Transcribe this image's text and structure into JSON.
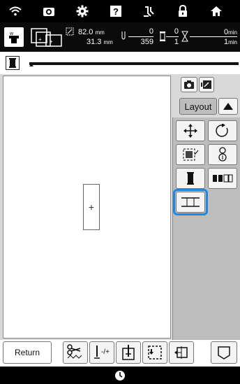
{
  "info": {
    "width_value": "82.0",
    "width_unit": "mm",
    "height_value": "31.3",
    "height_unit": "mm",
    "stitch_top": "0",
    "stitch_bottom": "359",
    "color_top": "0",
    "color_bottom": "1",
    "time_top": "0",
    "time_top_unit": "min",
    "time_bottom": "1",
    "time_bottom_unit": "min"
  },
  "canvas": {
    "crosshair": "+"
  },
  "right_panel": {
    "layout_label": "Layout"
  },
  "bottom": {
    "return_label": "Return"
  },
  "colors": {
    "selected_ring": "#1e88e5",
    "panel_bg": "#bdbdbd",
    "bar_bg": "#000000"
  },
  "icons": {
    "topbar": [
      "wifi-icon",
      "camera-icon",
      "settings-icon",
      "help-icon",
      "needle-icon",
      "lock-icon",
      "home-icon"
    ],
    "toolbox": [
      "move-icon",
      "rotate-icon",
      "embroidery-frame-icon",
      "snowman-icon",
      "thread-spool-icon",
      "colors-icon",
      "align-center-icon"
    ],
    "bottom": [
      "cut-jump-icon",
      "needle-stitch-icon",
      "frame-center-icon",
      "trace-icon",
      "cross-hair-icon",
      "pocket-icon"
    ]
  }
}
